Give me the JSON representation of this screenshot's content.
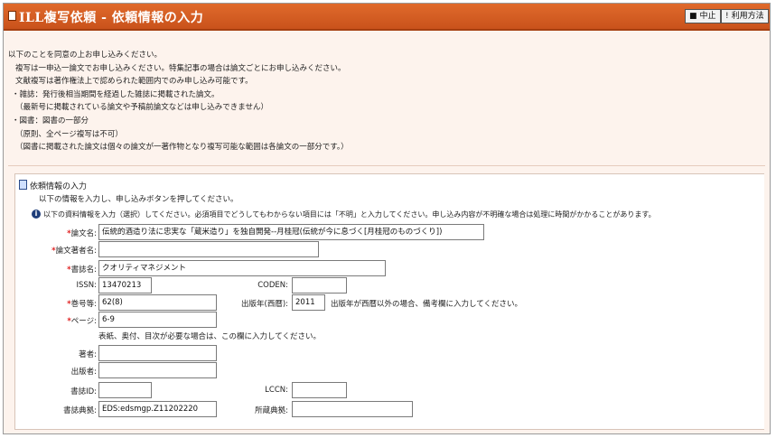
{
  "titlebar": {
    "title": "ILL複写依頼 - 依頼情報の入力",
    "cancel_label": "中止",
    "help_label": "利用方法"
  },
  "intro": [
    "以下のことを同意の上お申し込みください。",
    "複写は一申込一論文でお申し込みください。特集記事の場合は論文ごとにお申し込みください。",
    "文献複写は著作権法上で認められた範囲内でのみ申し込み可能です。",
    "・雑誌：発行後相当期間を経過した雑誌に掲載された論文。",
    "（最新号に掲載されている論文や予稿前論文などは申し込みできません）",
    "・図書：図書の一部分",
    "（原則、全ページ複写は不可）",
    "（図書に掲載された論文は個々の論文が一著作物となり複写可能な範囲は各論文の一部分です。）"
  ],
  "section": {
    "title": "依頼情報の入力",
    "note": "以下の情報を入力し、申し込みボタンを押してください。",
    "info": "以下の資料情報を入力（選択）してください。必須項目でどうしてもわからない項目には「不明」と入力してください。申し込み内容が不明確な場合は処理に時間がかかることがあります。"
  },
  "form": {
    "article_title": {
      "label": "論文名:",
      "value": "伝統的酒造り法に忠実な「蔵米造り」を独自開発--月桂冠(伝統が今に息づく[月桂冠のものづくり])"
    },
    "article_author": {
      "label": "論文著者名:",
      "value": ""
    },
    "journal_title": {
      "label": "書誌名:",
      "value": "クオリティマネジメント"
    },
    "issn": {
      "label": "ISSN:",
      "value": "13470213"
    },
    "coden": {
      "label": "CODEN:",
      "value": ""
    },
    "volume": {
      "label": "巻号等:",
      "value": "62(8)"
    },
    "pub_year": {
      "label": "出版年(西暦):",
      "value": "2011"
    },
    "pub_year_note": "出版年が西暦以外の場合、備考欄に入力してください。",
    "pages": {
      "label": "ページ:",
      "value": "6-9"
    },
    "pages_note": "表紙、奥付、目次が必要な場合は、この欄に入力してください。",
    "author": {
      "label": "著者:",
      "value": ""
    },
    "publisher": {
      "label": "出版者:",
      "value": ""
    },
    "bib_id": {
      "label": "書誌ID:",
      "value": ""
    },
    "lccn": {
      "label": "LCCN:",
      "value": ""
    },
    "bib_source": {
      "label": "書誌典拠:",
      "value": "EDS:edsmgp.Z11202220"
    },
    "holding_source": {
      "label": "所蔵典拠:",
      "value": ""
    }
  },
  "colors": {
    "titlebar": "#d35f24",
    "background": "#fdf3ed",
    "required": "#e02020"
  }
}
